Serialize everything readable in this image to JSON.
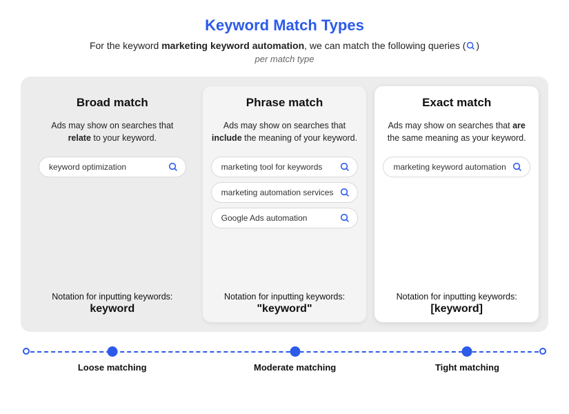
{
  "title": "Keyword Match Types",
  "subtitle_prefix": "For the keyword ",
  "subtitle_keyword": "marketing keyword automation",
  "subtitle_suffix": ", we can match the following queries (",
  "subtitle_close": ")",
  "per_match": "per match type",
  "columns": {
    "broad": {
      "heading": "Broad match",
      "desc_pre": "Ads may show on searches that ",
      "desc_em": "relate",
      "desc_post": " to your keyword.",
      "examples": [
        "keyword optimization"
      ],
      "notation_label": "Notation for inputting keywords:",
      "notation_value": "keyword"
    },
    "phrase": {
      "heading": "Phrase match",
      "desc_pre": "Ads may show on searches that ",
      "desc_em": "include",
      "desc_post": " the meaning of your keyword.",
      "examples": [
        "marketing tool for keywords",
        "marketing automation services",
        "Google Ads automation"
      ],
      "notation_label": "Notation for inputting keywords:",
      "notation_value": "\"keyword\""
    },
    "exact": {
      "heading": "Exact match",
      "desc_pre": "Ads may show on searches that ",
      "desc_em": "are",
      "desc_post": " the same meaning as your keyword.",
      "examples": [
        "marketing keyword automation"
      ],
      "notation_label": "Notation for inputting keywords:",
      "notation_value": "[keyword]"
    }
  },
  "scale": {
    "loose": "Loose matching",
    "moderate": "Moderate matching",
    "tight": "Tight matching"
  },
  "icons": {
    "search": "search-icon"
  },
  "colors": {
    "accent": "#2c5ae9"
  }
}
